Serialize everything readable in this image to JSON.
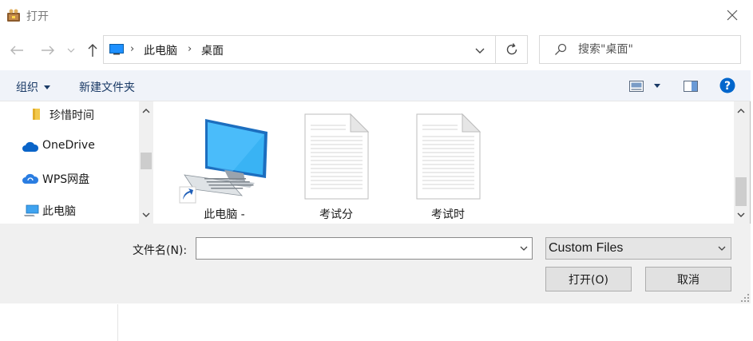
{
  "window": {
    "title": "打开"
  },
  "address_bar": {
    "crumbs": [
      "此电脑",
      "桌面"
    ]
  },
  "search": {
    "placeholder": "搜索\"桌面\""
  },
  "toolbar": {
    "organize_label": "组织",
    "new_folder_label": "新建文件夹"
  },
  "sidebar": {
    "items": [
      {
        "label": "珍惜时间",
        "icon": "folder-icon"
      },
      {
        "label": "OneDrive",
        "icon": "cloud-icon"
      },
      {
        "label": "WPS网盘",
        "icon": "wps-cloud-icon"
      },
      {
        "label": "此电脑",
        "icon": "computer-icon"
      }
    ]
  },
  "files": [
    {
      "label": "此电脑 -",
      "icon": "computer-shortcut-icon"
    },
    {
      "label": "考试分",
      "icon": "document-icon"
    },
    {
      "label": "考试时",
      "icon": "document-icon"
    }
  ],
  "footer": {
    "filename_label": "文件名(N):",
    "filename_value": "",
    "filetype_value": "Custom Files",
    "open_label": "打开(O)",
    "cancel_label": "取消"
  },
  "colors": {
    "accent": "#0078d7",
    "help": "#0066cc",
    "toolbar_text": "#1a3a66"
  }
}
